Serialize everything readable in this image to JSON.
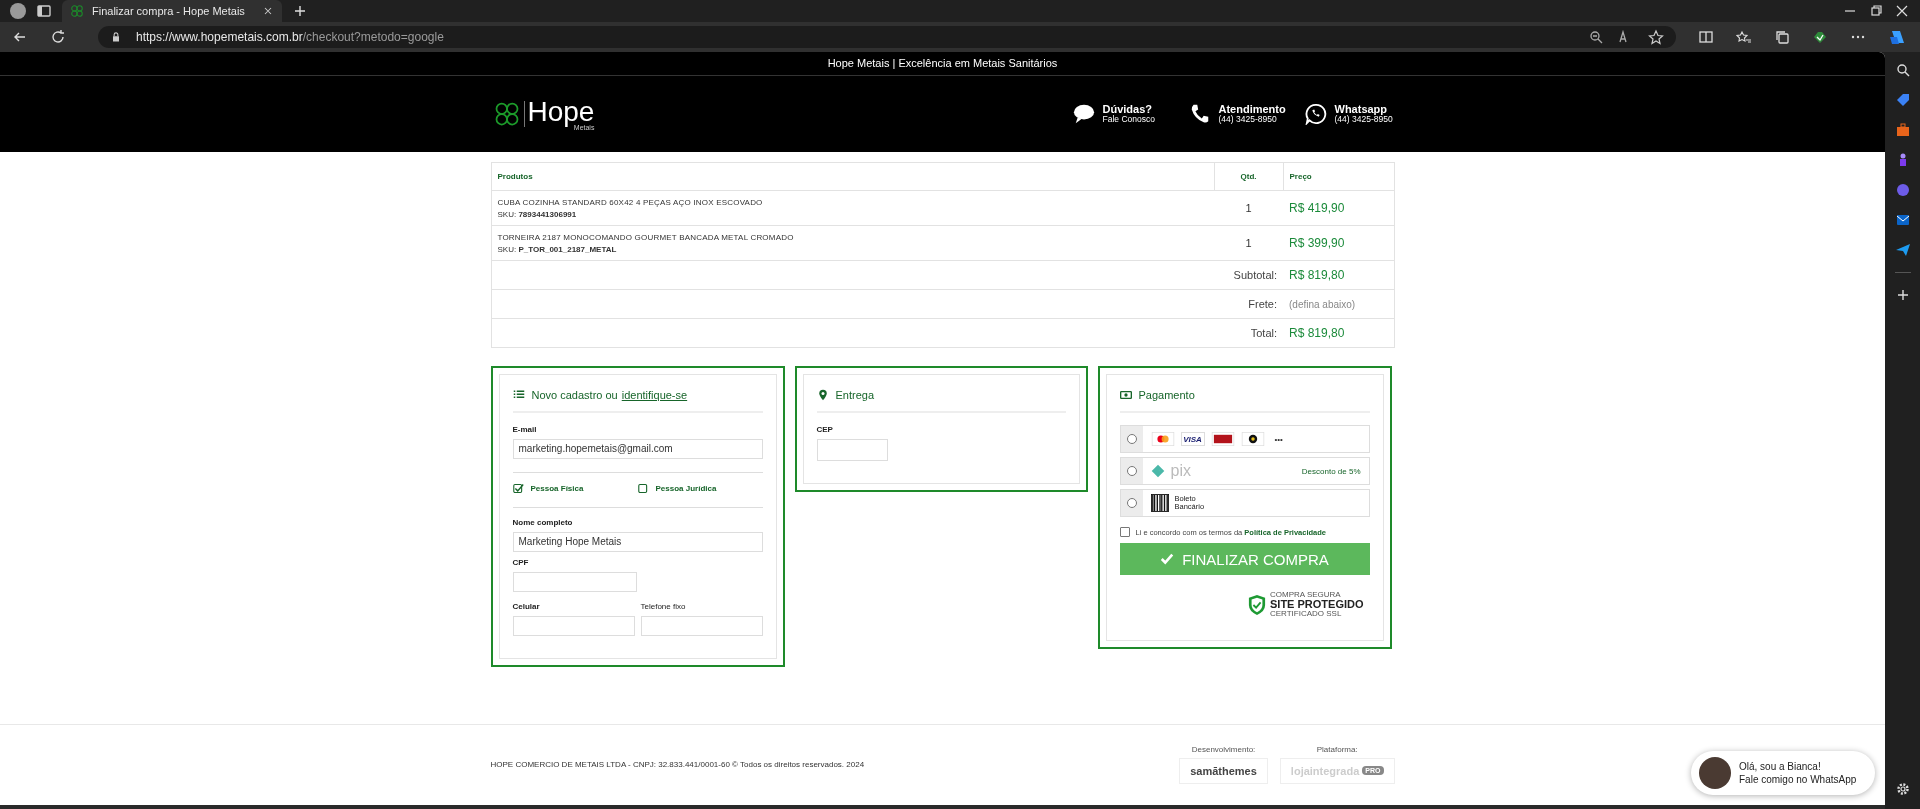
{
  "browser": {
    "tab_title": "Finalizar compra - Hope Metais",
    "url_host": "https://www.hopemetais.com.br",
    "url_path": "/checkout?metodo=google"
  },
  "top_banner": "Hope Metais | Excelência em Metais Sanitários",
  "header": {
    "logo": {
      "name": "Hope",
      "sub": "Metais"
    },
    "contacts": [
      {
        "kind": "chat",
        "title": "Dúvidas?",
        "sub": "Fale Conosco"
      },
      {
        "kind": "phone",
        "title": "Atendimento",
        "sub": "(44) 3425-8950"
      },
      {
        "kind": "whatsapp",
        "title": "Whatsapp",
        "sub": "(44) 3425-8950"
      }
    ]
  },
  "cart": {
    "columns": [
      "Produtos",
      "Qtd.",
      "Preço"
    ],
    "rows": [
      {
        "name": "CUBA COZINHA STANDARD 60X42 4 PEÇAS AÇO INOX ESCOVADO",
        "sku_label": "SKU:",
        "sku": "7893441306991",
        "qty": "1",
        "price": "R$ 419,90"
      },
      {
        "name": "TORNEIRA 2187 MONOCOMANDO GOURMET BANCADA METAL CROMADO",
        "sku_label": "SKU:",
        "sku": "P_TOR_001_2187_METAL",
        "qty": "1",
        "price": "R$ 399,90"
      }
    ],
    "totals": [
      {
        "label": "Subtotal:",
        "value": "R$ 819,80",
        "kind": "money"
      },
      {
        "label": "Frete:",
        "value": "(defina abaixo)",
        "kind": "note"
      },
      {
        "label": "Total:",
        "value": "R$ 819,80",
        "kind": "money"
      }
    ]
  },
  "register": {
    "title": "Novo cadastro ou",
    "link": "identifique-se",
    "email": {
      "label": "E-mail",
      "value": "marketing.hopemetais@gmail.com"
    },
    "person_types": [
      {
        "label": "Pessoa Física",
        "checked": true
      },
      {
        "label": "Pessoa Jurídica",
        "checked": false
      }
    ],
    "name": {
      "label": "Nome completo",
      "value": "Marketing Hope Metais"
    },
    "cpf": {
      "label": "CPF"
    },
    "phones": [
      {
        "label": "Celular"
      },
      {
        "label": "Telefone fixo"
      }
    ]
  },
  "delivery": {
    "title": "Entrega",
    "cep": {
      "label": "CEP"
    }
  },
  "payment": {
    "title": "Pagamento",
    "methods": [
      {
        "kind": "cards",
        "selected": false,
        "card_text": "VISA",
        "more": "•••"
      },
      {
        "kind": "pix",
        "selected": false,
        "logo": "pix",
        "note": "Desconto de 5%"
      },
      {
        "kind": "boleto",
        "selected": false,
        "label": "Boleto Bancário"
      }
    ],
    "terms": {
      "checked": false,
      "text": "Li e concordo com os termos da",
      "link": "Política de Privacidade"
    },
    "submit": "FINALIZAR COMPRA",
    "seal": {
      "top": "COMPRA SEGURA",
      "main": "SITE PROTEGIDO",
      "bottom": "CERTIFICADO SSL"
    }
  },
  "footer": {
    "legal": "HOPE COMERCIO DE METAIS LTDA - CNPJ: 32.833.441/0001-60 © Todos os direitos reservados. 2024",
    "dev_label": "Desenvolvimento:",
    "dev_logo": "samāthemes",
    "platform_label": "Plataforma:",
    "platform_logo": "lojaintegrada",
    "platform_badge": "PRO"
  },
  "chat_widget": {
    "line1": "Olá, sou a Bianca!",
    "line2": "Fale comigo no WhatsApp"
  }
}
